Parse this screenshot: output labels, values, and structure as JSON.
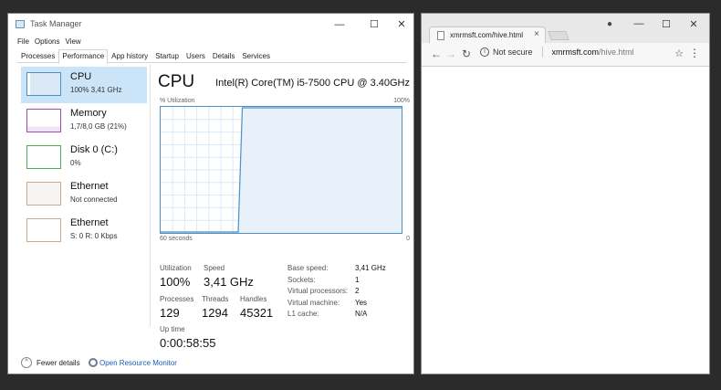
{
  "task_manager": {
    "title": "Task Manager",
    "controls": {
      "minimize": "—",
      "maximize": "☐",
      "close": "✕"
    },
    "menu": [
      "File",
      "Options",
      "View"
    ],
    "tabs": [
      "Processes",
      "Performance",
      "App history",
      "Startup",
      "Users",
      "Details",
      "Services"
    ],
    "active_tab": "Performance",
    "sidebar": [
      {
        "name": "CPU",
        "detail": "100%  3,41 GHz",
        "color": "#4a90c7"
      },
      {
        "name": "Memory",
        "detail": "1,7/8,0 GB (21%)",
        "color": "#9c4fb5"
      },
      {
        "name": "Disk 0 (C:)",
        "detail": "0%",
        "color": "#4caf50"
      },
      {
        "name": "Ethernet",
        "detail": "Not connected",
        "color": "#a7744a"
      },
      {
        "name": "Ethernet",
        "detail": "S: 0  R: 0 Kbps",
        "color": "#a7744a"
      }
    ],
    "cpu": {
      "title": "CPU",
      "model": "Intel(R) Core(TM) i5-7500 CPU @ 3.40GHz",
      "util_label": "% Utilization",
      "util_max": "100%",
      "x_left": "60 seconds",
      "x_right": "0",
      "utilization_history": [
        0,
        0,
        0,
        0,
        0,
        0,
        0,
        0,
        0,
        0,
        0,
        0,
        0,
        0,
        0,
        0,
        0,
        0,
        0,
        0,
        100,
        100,
        100,
        100,
        100,
        100,
        100,
        100,
        100,
        100,
        100,
        100,
        100,
        100,
        100,
        100,
        100,
        100,
        100,
        100,
        100,
        100,
        100,
        100,
        100,
        100,
        100,
        100,
        100,
        100,
        100,
        100,
        100,
        100,
        100,
        100,
        100,
        100,
        100,
        100
      ],
      "stats": {
        "utilization_label": "Utilization",
        "utilization": "100%",
        "speed_label": "Speed",
        "speed": "3,41 GHz",
        "processes_label": "Processes",
        "processes": "129",
        "threads_label": "Threads",
        "threads": "1294",
        "handles_label": "Handles",
        "handles": "45321",
        "uptime_label": "Up time",
        "uptime": "0:00:58:55"
      },
      "specs": [
        {
          "k": "Base speed:",
          "v": "3,41 GHz"
        },
        {
          "k": "Sockets:",
          "v": "1"
        },
        {
          "k": "Virtual processors:",
          "v": "2"
        },
        {
          "k": "Virtual machine:",
          "v": "Yes"
        },
        {
          "k": "L1 cache:",
          "v": "N/A"
        }
      ]
    },
    "footer": {
      "fewer": "Fewer details",
      "resource_monitor": "Open Resource Monitor"
    }
  },
  "browser": {
    "tab_title": "xmrmsft.com/hive.html",
    "tab_close": "×",
    "controls": {
      "minimize": "—",
      "maximize": "☐",
      "close": "✕"
    },
    "security": "Not secure",
    "url_host": "xmrmsft.com",
    "url_path": "/hive.html"
  }
}
